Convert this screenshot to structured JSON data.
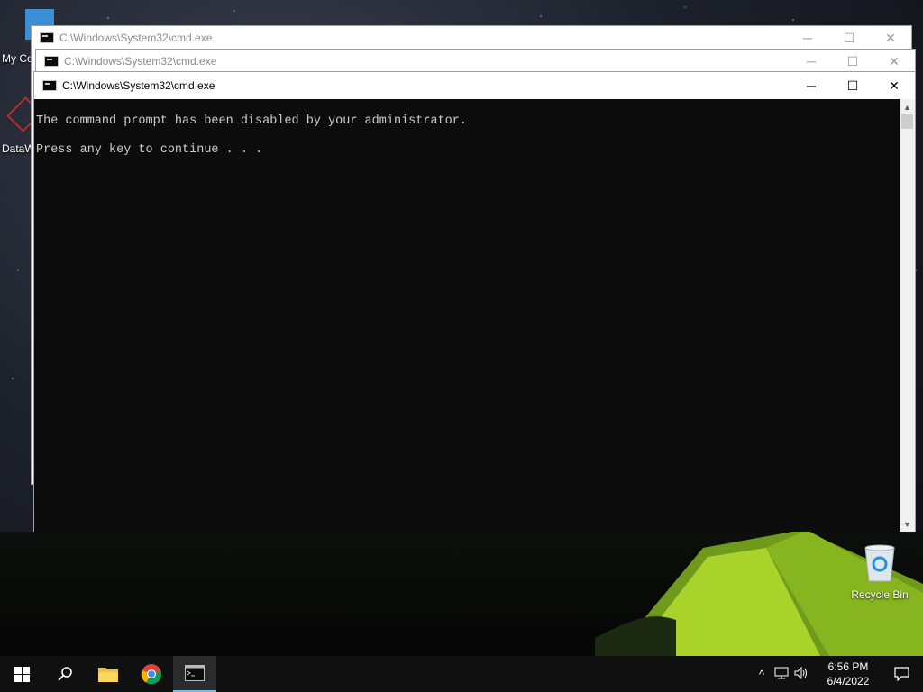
{
  "desktop": {
    "icons": [
      {
        "label": "My Co"
      },
      {
        "label": "DataW"
      },
      {
        "label": "Recycle Bin"
      }
    ]
  },
  "windows": [
    {
      "title": "C:\\Windows\\System32\\cmd.exe",
      "state": "inactive"
    },
    {
      "title": "C:\\Windows\\System32\\cmd.exe",
      "state": "inactive"
    },
    {
      "title": "C:\\Windows\\System32\\cmd.exe",
      "state": "active"
    }
  ],
  "console": {
    "lines": [
      "The command prompt has been disabled by your administrator.",
      "Press any key to continue . . ."
    ]
  },
  "controls": {
    "minimize": "─",
    "maximize": "☐",
    "close": "✕"
  },
  "taskbar": {
    "items": [
      {
        "icon": "windows-start-icon"
      },
      {
        "icon": "search-icon"
      },
      {
        "icon": "file-explorer-icon"
      },
      {
        "icon": "chrome-icon"
      },
      {
        "icon": "cmd-icon"
      }
    ],
    "tray": {
      "chevron": "^",
      "time": "6:56 PM",
      "date": "6/4/2022"
    }
  },
  "colors": {
    "console_bg": "#0c0c0c",
    "console_fg": "#cccccc",
    "taskbar_bg": "#101010",
    "accent": "#76b9ed"
  }
}
